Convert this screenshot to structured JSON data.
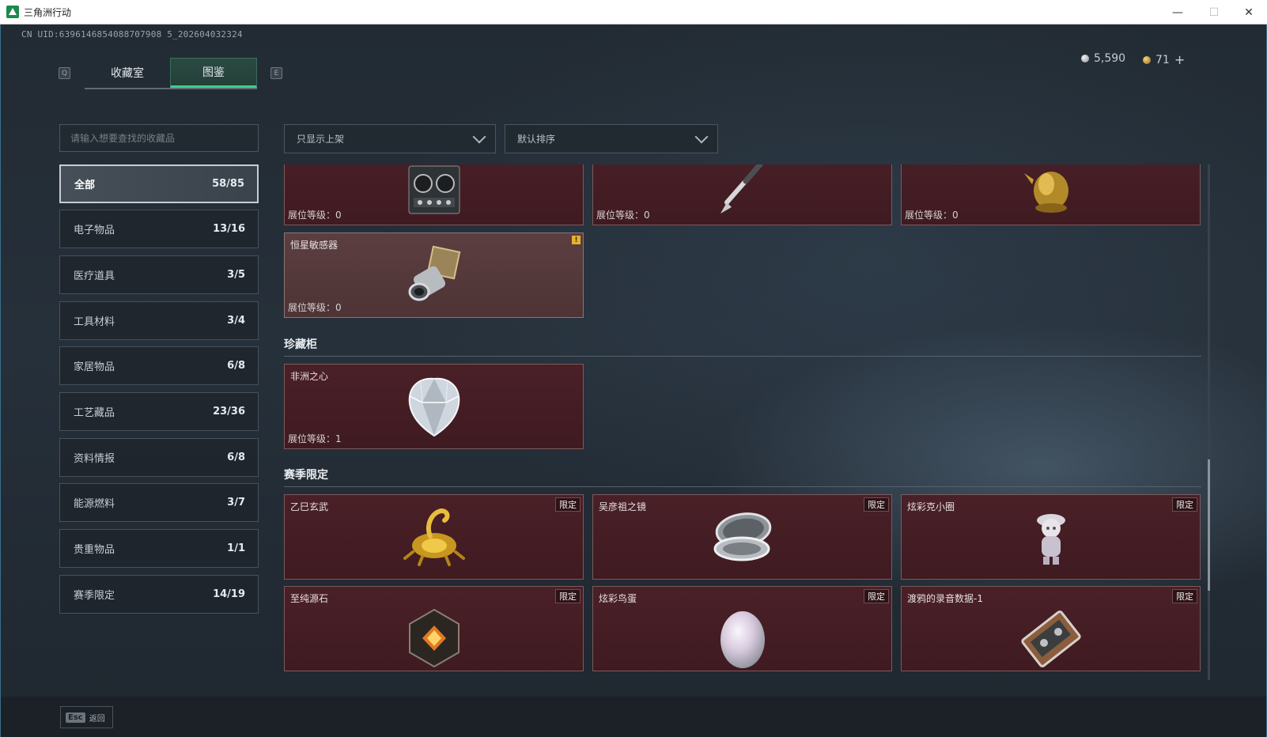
{
  "window": {
    "title": "三角洲行动",
    "controls": [
      "minimize",
      "maximize",
      "close"
    ]
  },
  "header": {
    "uid": "CN UID:6396146854088707908 5_202604032324",
    "key_left": "Q",
    "key_right": "E",
    "tabs": [
      {
        "label": "收藏室",
        "active": false
      },
      {
        "label": "图鉴",
        "active": true
      }
    ],
    "currency_silver": "5,590",
    "currency_gold": "71",
    "currency_add": "+"
  },
  "sidebar": {
    "search_placeholder": "请输入想要查找的收藏品",
    "categories": [
      {
        "label": "全部",
        "count": "58/85",
        "active": true
      },
      {
        "label": "电子物品",
        "count": "13/16"
      },
      {
        "label": "医疗道具",
        "count": "3/5"
      },
      {
        "label": "工具材料",
        "count": "3/4"
      },
      {
        "label": "家居物品",
        "count": "6/8"
      },
      {
        "label": "工艺藏品",
        "count": "23/36"
      },
      {
        "label": "资料情报",
        "count": "6/8"
      },
      {
        "label": "能源燃料",
        "count": "3/7"
      },
      {
        "label": "贵重物品",
        "count": "1/1"
      },
      {
        "label": "赛季限定",
        "count": "14/19"
      }
    ]
  },
  "filters": {
    "display": "只显示上架",
    "sort": "默认排序"
  },
  "content": {
    "top_row": [
      {
        "level_label": "展位等级：",
        "level": "0",
        "icon": "recorder-device-icon"
      },
      {
        "level_label": "展位等级：",
        "level": "0",
        "icon": "fountain-pen-icon"
      },
      {
        "level_label": "展位等级：",
        "level": "0",
        "icon": "gold-statue-icon"
      }
    ],
    "star_sensor": {
      "name": "恒星敏感器",
      "level_label": "展位等级：",
      "level": "0",
      "warn": "!"
    },
    "section_cabinet": "珍藏柜",
    "heart": {
      "name": "非洲之心",
      "level_label": "展位等级：",
      "level": "1"
    },
    "section_season": "赛季限定",
    "season_items": [
      {
        "name": "乙巳玄武",
        "tag": "限定",
        "icon": "gold-dragon-icon"
      },
      {
        "name": "吴彦祖之镜",
        "tag": "限定",
        "icon": "compact-mirror-icon"
      },
      {
        "name": "炫彩克小圈",
        "tag": "限定",
        "icon": "figurine-icon"
      },
      {
        "name": "至纯源石",
        "tag": "限定",
        "icon": "source-stone-icon"
      },
      {
        "name": "炫彩鸟蛋",
        "tag": "限定",
        "icon": "pearl-egg-icon"
      },
      {
        "name": "渡鸦的录音数据-1",
        "tag": "限定",
        "icon": "cassette-tape-icon"
      }
    ]
  },
  "footer": {
    "esc_key": "Esc",
    "back_label": "返回"
  }
}
